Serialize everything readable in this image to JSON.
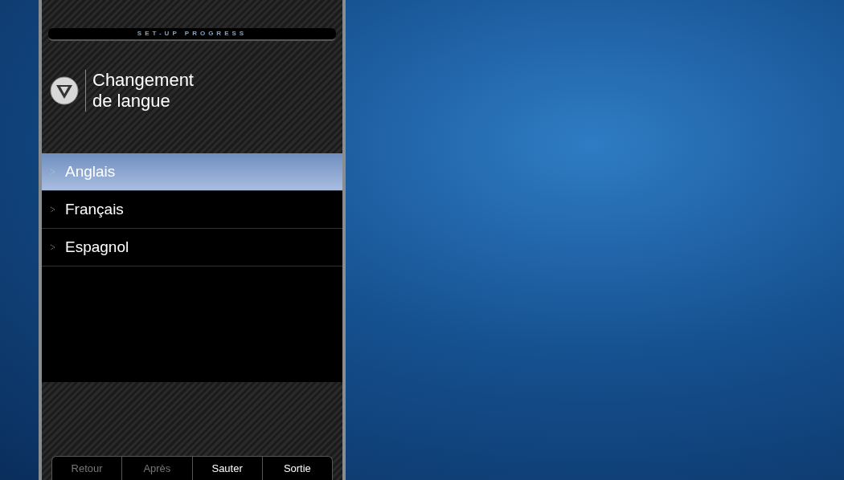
{
  "progress_label": "SET-UP PROGRESS",
  "title": "Changement de langue",
  "languages": [
    {
      "label": "Anglais",
      "selected": true
    },
    {
      "label": "Français",
      "selected": false
    },
    {
      "label": "Espagnol",
      "selected": false
    }
  ],
  "buttons": [
    {
      "label": "Retour",
      "disabled": true
    },
    {
      "label": "Après",
      "disabled": true
    },
    {
      "label": "Sauter",
      "disabled": false
    },
    {
      "label": "Sortie",
      "disabled": false
    }
  ]
}
